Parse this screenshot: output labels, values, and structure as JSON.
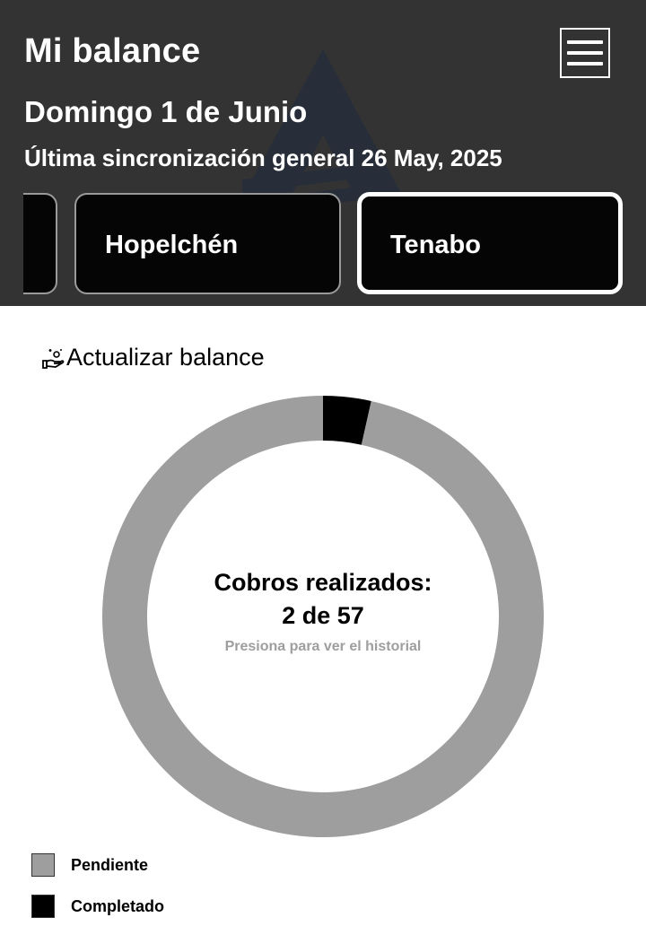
{
  "header": {
    "title": "Mi balance",
    "date": "Domingo 1 de Junio",
    "sync": "Última sincronización general 26 May, 2025",
    "menu_icon": "hamburger-menu-icon",
    "colors": {
      "background": "#333333",
      "text": "#ffffff"
    }
  },
  "branches": [
    {
      "label": "",
      "active": false
    },
    {
      "label": "Hopelchén",
      "active": false
    },
    {
      "label": "Tenabo",
      "active": true
    }
  ],
  "update": {
    "icon": "hand-money-icon",
    "label": "Actualizar balance"
  },
  "summary": {
    "line1": "Cobros realizados:",
    "line2": "2 de 57",
    "hint": "Presiona para ver el historial"
  },
  "chart_data": {
    "type": "pie",
    "donut": true,
    "categories": [
      "Pendiente",
      "Completado"
    ],
    "values": [
      55,
      2
    ],
    "colors": [
      "#9e9e9e",
      "#000000"
    ],
    "legend": "bottom-left"
  }
}
